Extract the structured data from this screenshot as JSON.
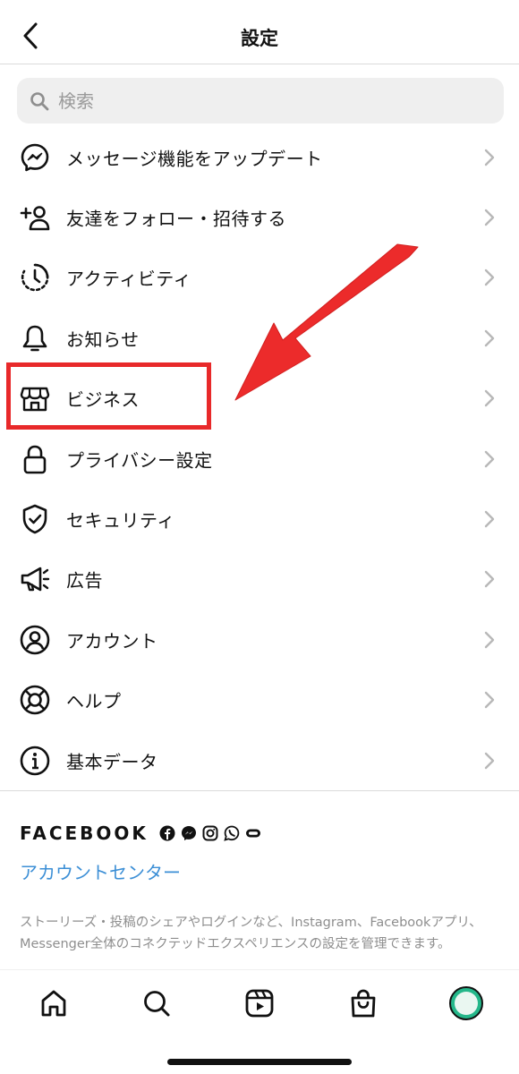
{
  "header": {
    "title": "設定",
    "back_icon": "chevron-left-icon"
  },
  "search": {
    "placeholder": "検索",
    "value": ""
  },
  "menu": [
    {
      "label": "メッセージ機能をアップデート",
      "icon": "messenger-icon"
    },
    {
      "label": "友達をフォロー・招待する",
      "icon": "add-person-icon"
    },
    {
      "label": "アクティビティ",
      "icon": "activity-clock-icon"
    },
    {
      "label": "お知らせ",
      "icon": "bell-icon"
    },
    {
      "label": "ビジネス",
      "icon": "shop-icon"
    },
    {
      "label": "プライバシー設定",
      "icon": "lock-icon"
    },
    {
      "label": "セキュリティ",
      "icon": "shield-check-icon"
    },
    {
      "label": "広告",
      "icon": "megaphone-icon"
    },
    {
      "label": "アカウント",
      "icon": "user-circle-icon"
    },
    {
      "label": "ヘルプ",
      "icon": "lifebuoy-icon"
    },
    {
      "label": "基本データ",
      "icon": "info-icon"
    }
  ],
  "facebook": {
    "logo": "FACEBOOK",
    "account_center": "アカウントセンター",
    "description": "ストーリーズ・投稿のシェアやログインなど、Instagram、Facebookアプリ、Messenger全体のコネクテッドエクスペリエンスの設定を管理できます。"
  },
  "tabbar": [
    "home-icon",
    "search-icon",
    "reels-icon",
    "shop-bag-icon",
    "profile-avatar"
  ],
  "colors": {
    "accent_link": "#3c8fd6",
    "annotation": "#e8292a",
    "text": "#111111",
    "muted": "#8e8e8e"
  }
}
